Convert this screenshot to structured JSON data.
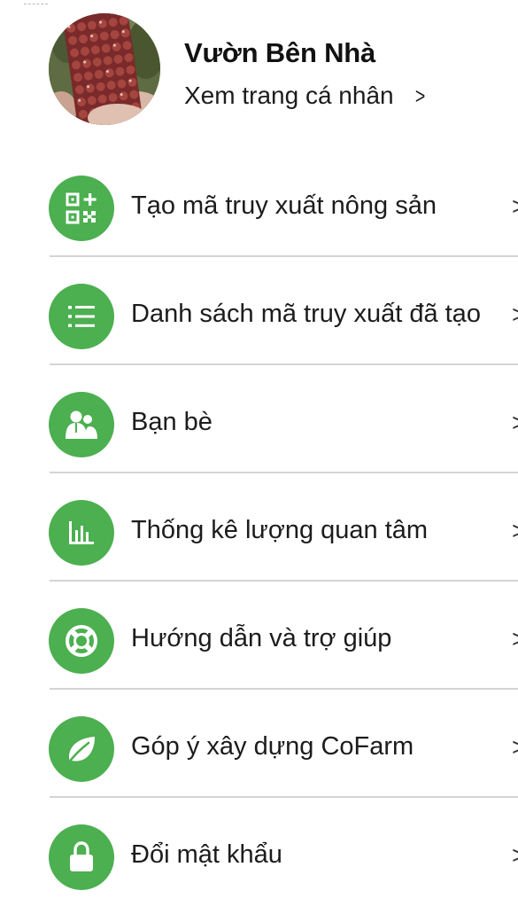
{
  "profile": {
    "name": "Vườn Bên Nhà",
    "view_profile_label": "Xem trang cá nhân",
    "chevron": ">"
  },
  "menu": {
    "items": [
      {
        "label": "Tạo mã truy xuất nông sản",
        "icon": "qr-add-icon"
      },
      {
        "label": "Danh sách mã truy xuất đã tạo",
        "icon": "list-icon"
      },
      {
        "label": "Bạn bè",
        "icon": "friends-icon"
      },
      {
        "label": "Thống kê lượng quan tâm",
        "icon": "bar-chart-icon"
      },
      {
        "label": "Hướng dẫn và trợ giúp",
        "icon": "lifebuoy-icon"
      },
      {
        "label": "Góp ý xây dựng CoFarm",
        "icon": "leaf-icon"
      },
      {
        "label": "Đổi mật khẩu",
        "icon": "lock-icon"
      }
    ],
    "chevron": ">"
  },
  "colors": {
    "icon_background": "#4caf50",
    "divider": "#d4d4d4",
    "text": "#1c1c1e"
  }
}
